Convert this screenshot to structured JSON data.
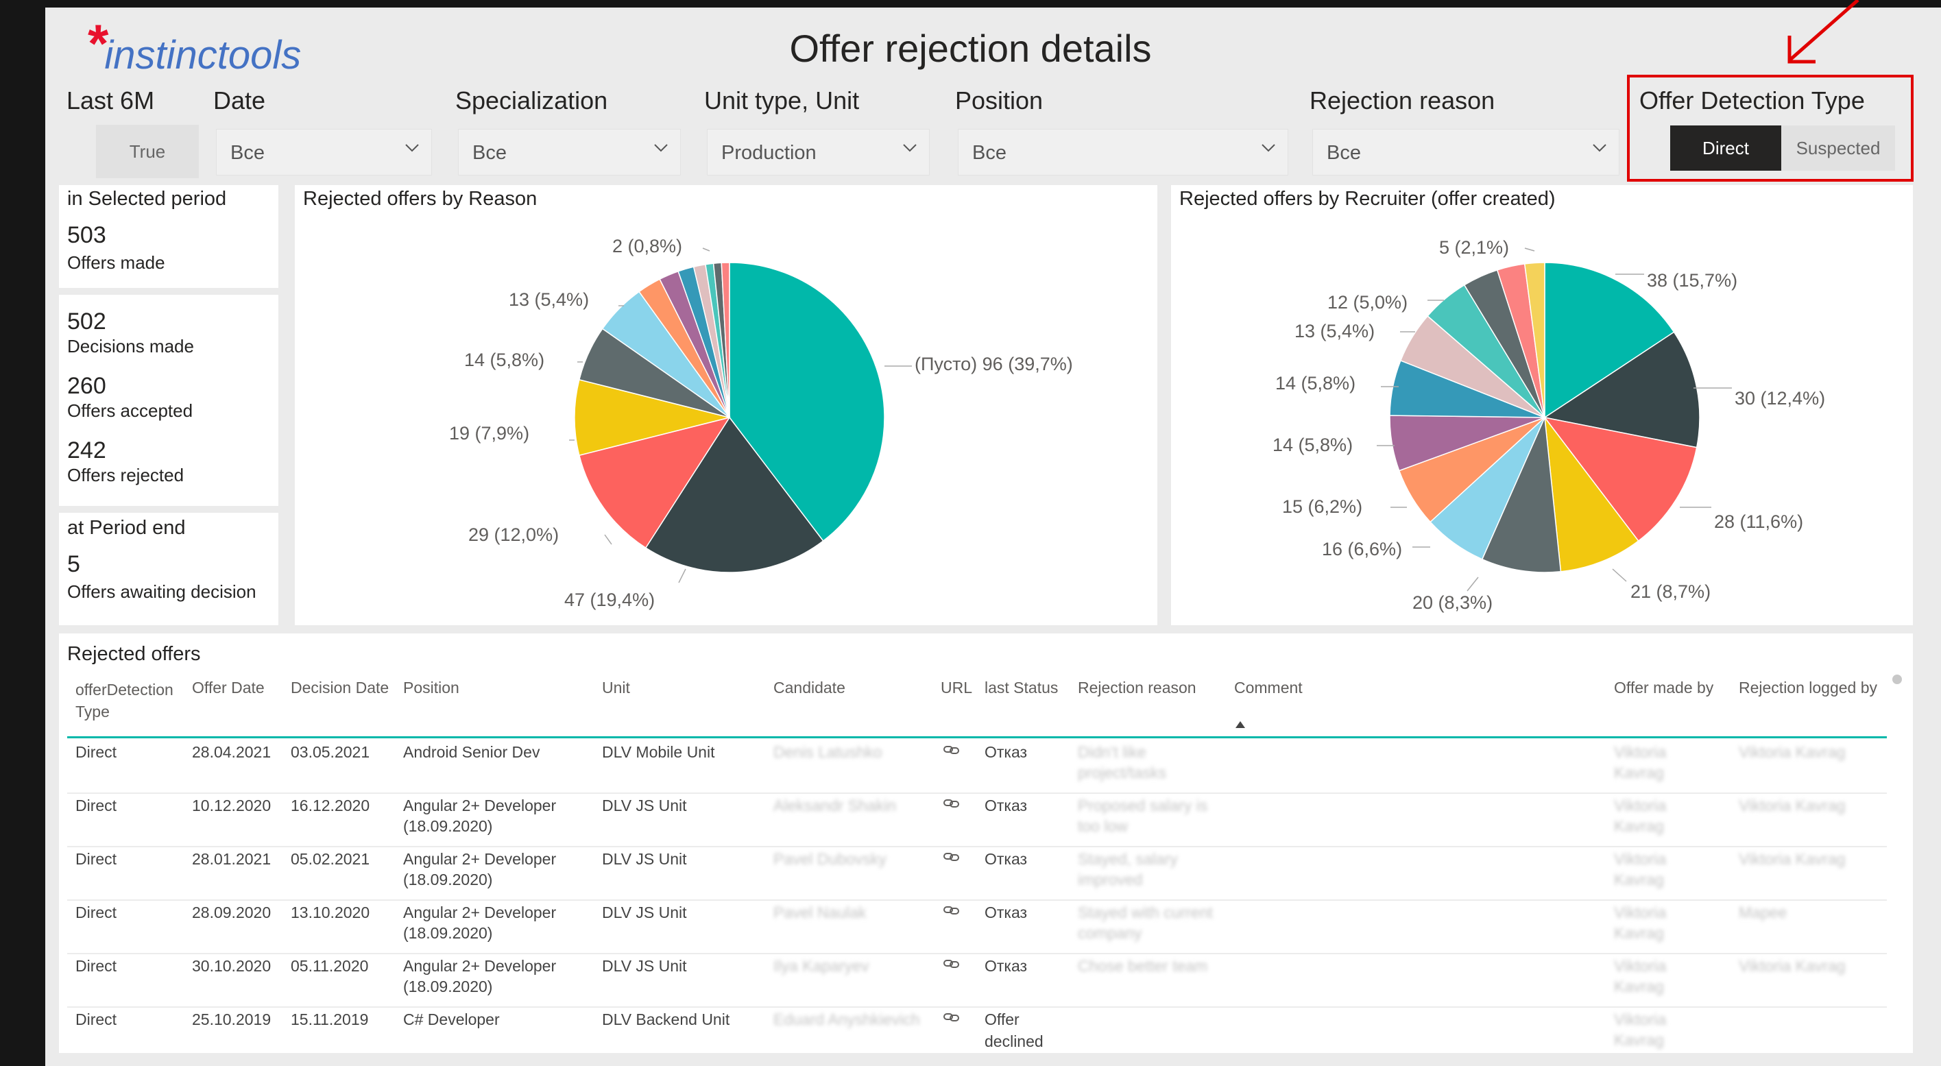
{
  "header": {
    "logo_text": "instinctools",
    "title": "Offer rejection details"
  },
  "filters": {
    "last6m": {
      "label": "Last 6M",
      "value": "True"
    },
    "date": {
      "label": "Date",
      "value": "Все"
    },
    "specialization": {
      "label": "Specialization",
      "value": "Все"
    },
    "unit": {
      "label": "Unit type, Unit",
      "value": "Production"
    },
    "position": {
      "label": "Position",
      "value": "Все"
    },
    "rejection_reason": {
      "label": "Rejection reason",
      "value": "Все"
    },
    "detection_type": {
      "label": "Offer Detection Type",
      "options": [
        "Direct",
        "Suspected"
      ],
      "selected": "Direct"
    }
  },
  "kpis": {
    "selected_period_title": "in Selected period",
    "offers_made": {
      "value": "503",
      "label": "Offers made"
    },
    "decisions_made": {
      "value": "502",
      "label": "Decisions made"
    },
    "offers_accepted": {
      "value": "260",
      "label": "Offers accepted"
    },
    "offers_rejected": {
      "value": "242",
      "label": "Offers rejected"
    },
    "period_end_title": "at Period end",
    "offers_awaiting": {
      "value": "5",
      "label": "Offers awaiting decision"
    }
  },
  "chart_data": [
    {
      "type": "pie",
      "title": "Rejected offers by Reason",
      "slices": [
        {
          "label": "(Пусто) 96 (39,7%)",
          "value": 96,
          "color": "#01b8aa"
        },
        {
          "label": "47 (19,4%)",
          "value": 47,
          "color": "#374649"
        },
        {
          "label": "29 (12,0%)",
          "value": 29,
          "color": "#fd625e"
        },
        {
          "label": "19 (7,9%)",
          "value": 19,
          "color": "#f2c80f"
        },
        {
          "label": "14 (5,8%)",
          "value": 14,
          "color": "#5f6b6d"
        },
        {
          "label": "13 (5,4%)",
          "value": 13,
          "color": "#8ad4eb"
        },
        {
          "label": "",
          "value": 6,
          "color": "#fe9666"
        },
        {
          "label": "",
          "value": 5,
          "color": "#a66999"
        },
        {
          "label": "",
          "value": 4,
          "color": "#3599b8"
        },
        {
          "label": "",
          "value": 3,
          "color": "#dfbfbf"
        },
        {
          "label": "",
          "value": 2,
          "color": "#4ac5bb"
        },
        {
          "label": "",
          "value": 2,
          "color": "#5f6b6d"
        },
        {
          "label": "2 (0,8%)",
          "value": 2,
          "color": "#fb8281"
        }
      ]
    },
    {
      "type": "pie",
      "title": "Rejected offers by Recruiter (offer created)",
      "slices": [
        {
          "label": "38 (15,7%)",
          "value": 38,
          "color": "#01b8aa"
        },
        {
          "label": "30 (12,4%)",
          "value": 30,
          "color": "#374649"
        },
        {
          "label": "28 (11,6%)",
          "value": 28,
          "color": "#fd625e"
        },
        {
          "label": "21 (8,7%)",
          "value": 21,
          "color": "#f2c80f"
        },
        {
          "label": "20 (8,3%)",
          "value": 20,
          "color": "#5f6b6d"
        },
        {
          "label": "16 (6,6%)",
          "value": 16,
          "color": "#8ad4eb"
        },
        {
          "label": "15 (6,2%)",
          "value": 15,
          "color": "#fe9666"
        },
        {
          "label": "14 (5,8%)",
          "value": 14,
          "color": "#a66999"
        },
        {
          "label": "14 (5,8%)",
          "value": 14,
          "color": "#3599b8"
        },
        {
          "label": "13 (5,4%)",
          "value": 13,
          "color": "#dfbfbf"
        },
        {
          "label": "12 (5,0%)",
          "value": 12,
          "color": "#4ac5bb"
        },
        {
          "label": "",
          "value": 9,
          "color": "#5f6b6d"
        },
        {
          "label": "",
          "value": 7,
          "color": "#fb8281"
        },
        {
          "label": "5 (2,1%)",
          "value": 5,
          "color": "#f4d25a"
        }
      ]
    }
  ],
  "reason_labels": {
    "r1": "(Пусто) 96 (39,7%)",
    "r2": "47 (19,4%)",
    "r3": "29 (12,0%)",
    "r4": "19 (7,9%)",
    "r5": "14 (5,8%)",
    "r6": "13 (5,4%)",
    "r7": "2 (0,8%)"
  },
  "recruiter_labels": {
    "c1": "38 (15,7%)",
    "c2": "30 (12,4%)",
    "c3": "28 (11,6%)",
    "c4": "21 (8,7%)",
    "c5": "20 (8,3%)",
    "c6": "16 (6,6%)",
    "c7": "15 (6,2%)",
    "c8": "14 (5,8%)",
    "c9": "14 (5,8%)",
    "c10": "13 (5,4%)",
    "c11": "12 (5,0%)",
    "c12": "5 (2,1%)"
  },
  "table": {
    "title": "Rejected offers",
    "headers": {
      "type": "offerDetection Type",
      "offer_date": "Offer Date",
      "decision_date": "Decision Date",
      "position": "Position",
      "unit": "Unit",
      "candidate": "Candidate",
      "url": "URL",
      "status": "last Status",
      "reason": "Rejection reason",
      "comment": "Comment",
      "made_by": "Offer made by",
      "logged_by": "Rejection logged by"
    },
    "rows": [
      {
        "type": "Direct",
        "offer_date": "28.04.2021",
        "decision_date": "03.05.2021",
        "position": "Android Senior Dev",
        "position2": "",
        "unit": "DLV Mobile Unit",
        "status": "Отказ",
        "status2": ""
      },
      {
        "type": "Direct",
        "offer_date": "10.12.2020",
        "decision_date": "16.12.2020",
        "position": "Angular 2+ Developer",
        "position2": "(18.09.2020)",
        "unit": "DLV JS Unit",
        "status": "Отказ",
        "status2": ""
      },
      {
        "type": "Direct",
        "offer_date": "28.01.2021",
        "decision_date": "05.02.2021",
        "position": "Angular 2+ Developer",
        "position2": "(18.09.2020)",
        "unit": "DLV JS Unit",
        "status": "Отказ",
        "status2": ""
      },
      {
        "type": "Direct",
        "offer_date": "28.09.2020",
        "decision_date": "13.10.2020",
        "position": "Angular 2+ Developer",
        "position2": "(18.09.2020)",
        "unit": "DLV JS Unit",
        "status": "Отказ",
        "status2": ""
      },
      {
        "type": "Direct",
        "offer_date": "30.10.2020",
        "decision_date": "05.11.2020",
        "position": "Angular 2+ Developer",
        "position2": "(18.09.2020)",
        "unit": "DLV JS Unit",
        "status": "Отказ",
        "status2": ""
      },
      {
        "type": "Direct",
        "offer_date": "25.10.2019",
        "decision_date": "15.11.2019",
        "position": "C# Developer",
        "position2": "",
        "unit": "DLV Backend Unit",
        "status": "Offer",
        "status2": "declined"
      }
    ]
  }
}
